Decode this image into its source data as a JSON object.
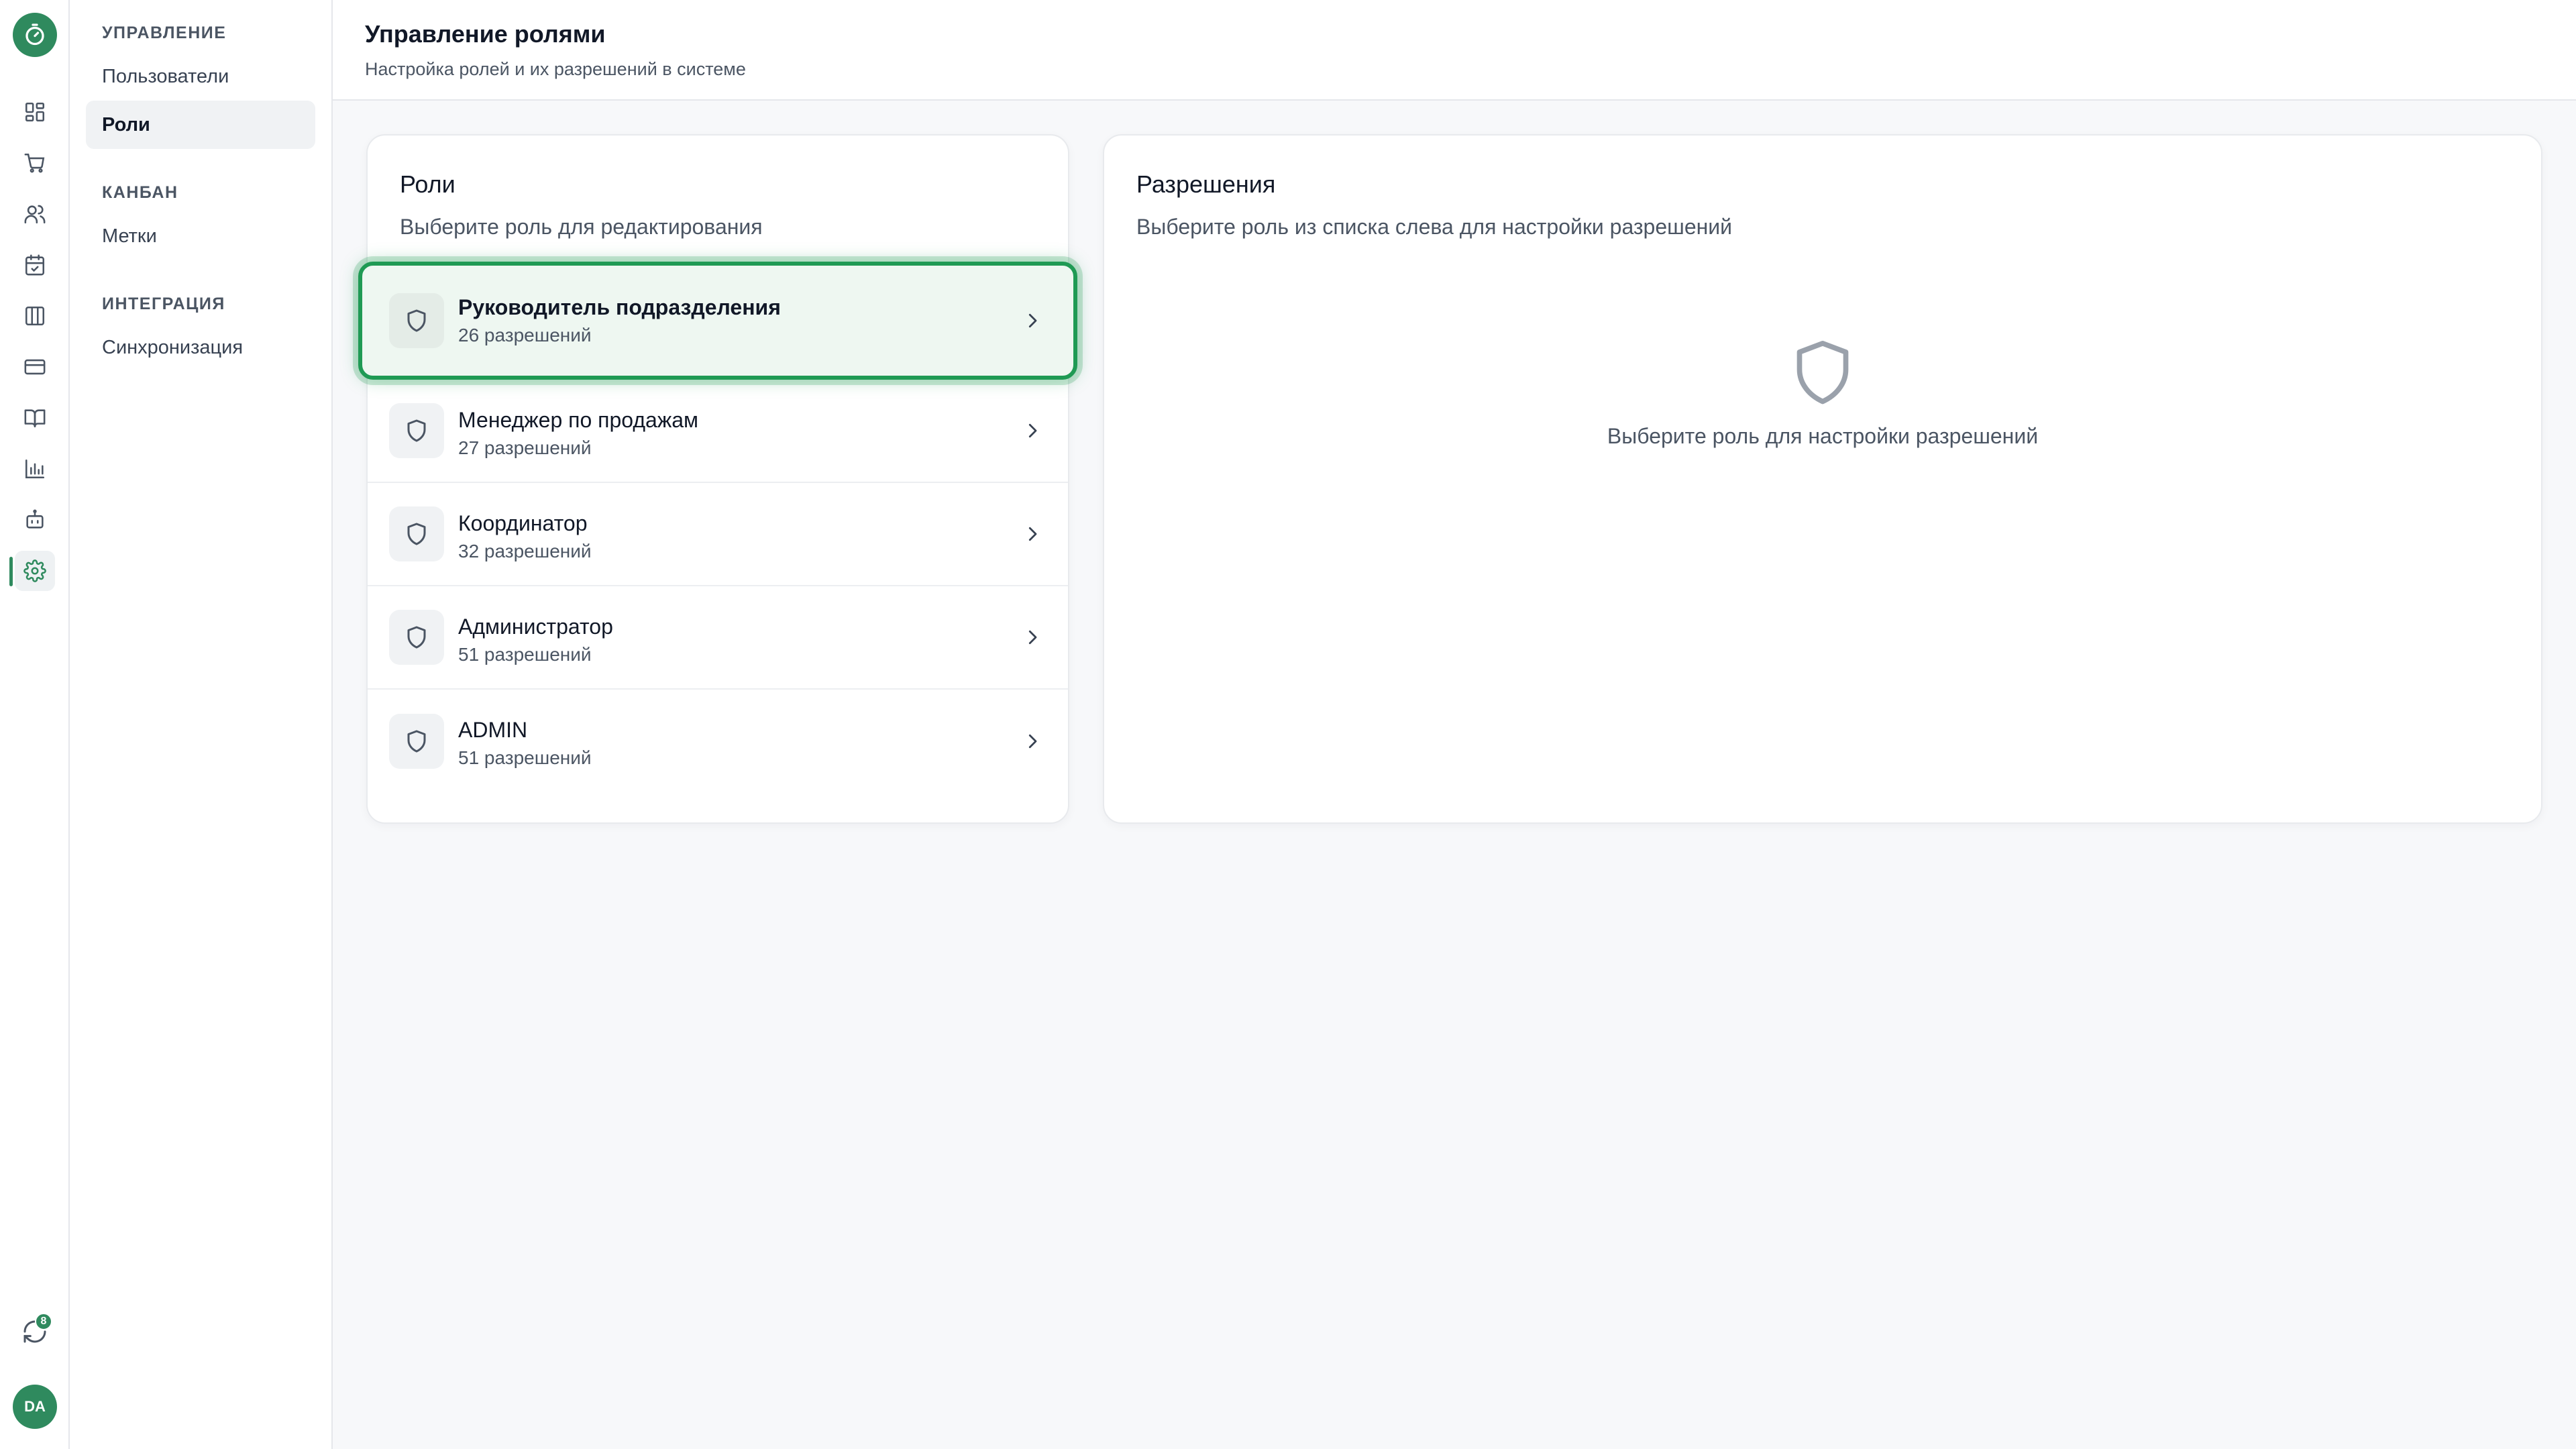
{
  "rail": {
    "items": [
      {
        "icon": "dashboard-icon"
      },
      {
        "icon": "cart-icon"
      },
      {
        "icon": "users-icon"
      },
      {
        "icon": "calendar-check-icon"
      },
      {
        "icon": "columns-icon"
      },
      {
        "icon": "credit-card-icon"
      },
      {
        "icon": "book-icon"
      },
      {
        "icon": "bar-chart-icon"
      },
      {
        "icon": "bot-icon"
      },
      {
        "icon": "gear-icon",
        "active": true
      }
    ],
    "sync_badge": "8",
    "avatar_initials": "DA"
  },
  "sidebar": {
    "sections": [
      {
        "title": "УПРАВЛЕНИЕ",
        "items": [
          {
            "label": "Пользователи"
          },
          {
            "label": "Роли",
            "active": true
          }
        ]
      },
      {
        "title": "КАНБАН",
        "items": [
          {
            "label": "Метки"
          }
        ]
      },
      {
        "title": "ИНТЕГРАЦИЯ",
        "items": [
          {
            "label": "Синхронизация"
          }
        ]
      }
    ]
  },
  "header": {
    "title": "Управление ролями",
    "subtitle": "Настройка ролей и их разрешений в системе"
  },
  "roles_card": {
    "title": "Роли",
    "subtitle": "Выберите роль для редактирования",
    "roles": [
      {
        "name": "Руководитель подразделения",
        "count": "26 разрешений",
        "selected": true
      },
      {
        "name": "Менеджер по продажам",
        "count": "27 разрешений"
      },
      {
        "name": "Координатор",
        "count": "32 разрешений"
      },
      {
        "name": "Администратор",
        "count": "51 разрешений"
      },
      {
        "name": "ADMIN",
        "count": "51 разрешений"
      }
    ]
  },
  "permissions_card": {
    "title": "Разрешения",
    "subtitle": "Выберите роль из списка слева для настройки разрешений",
    "empty_text": "Выберите роль для настройки разрешений"
  },
  "colors": {
    "accent": "#2f8a5e",
    "selected_border": "#1f9a54",
    "selected_bg": "#eef7f1"
  }
}
